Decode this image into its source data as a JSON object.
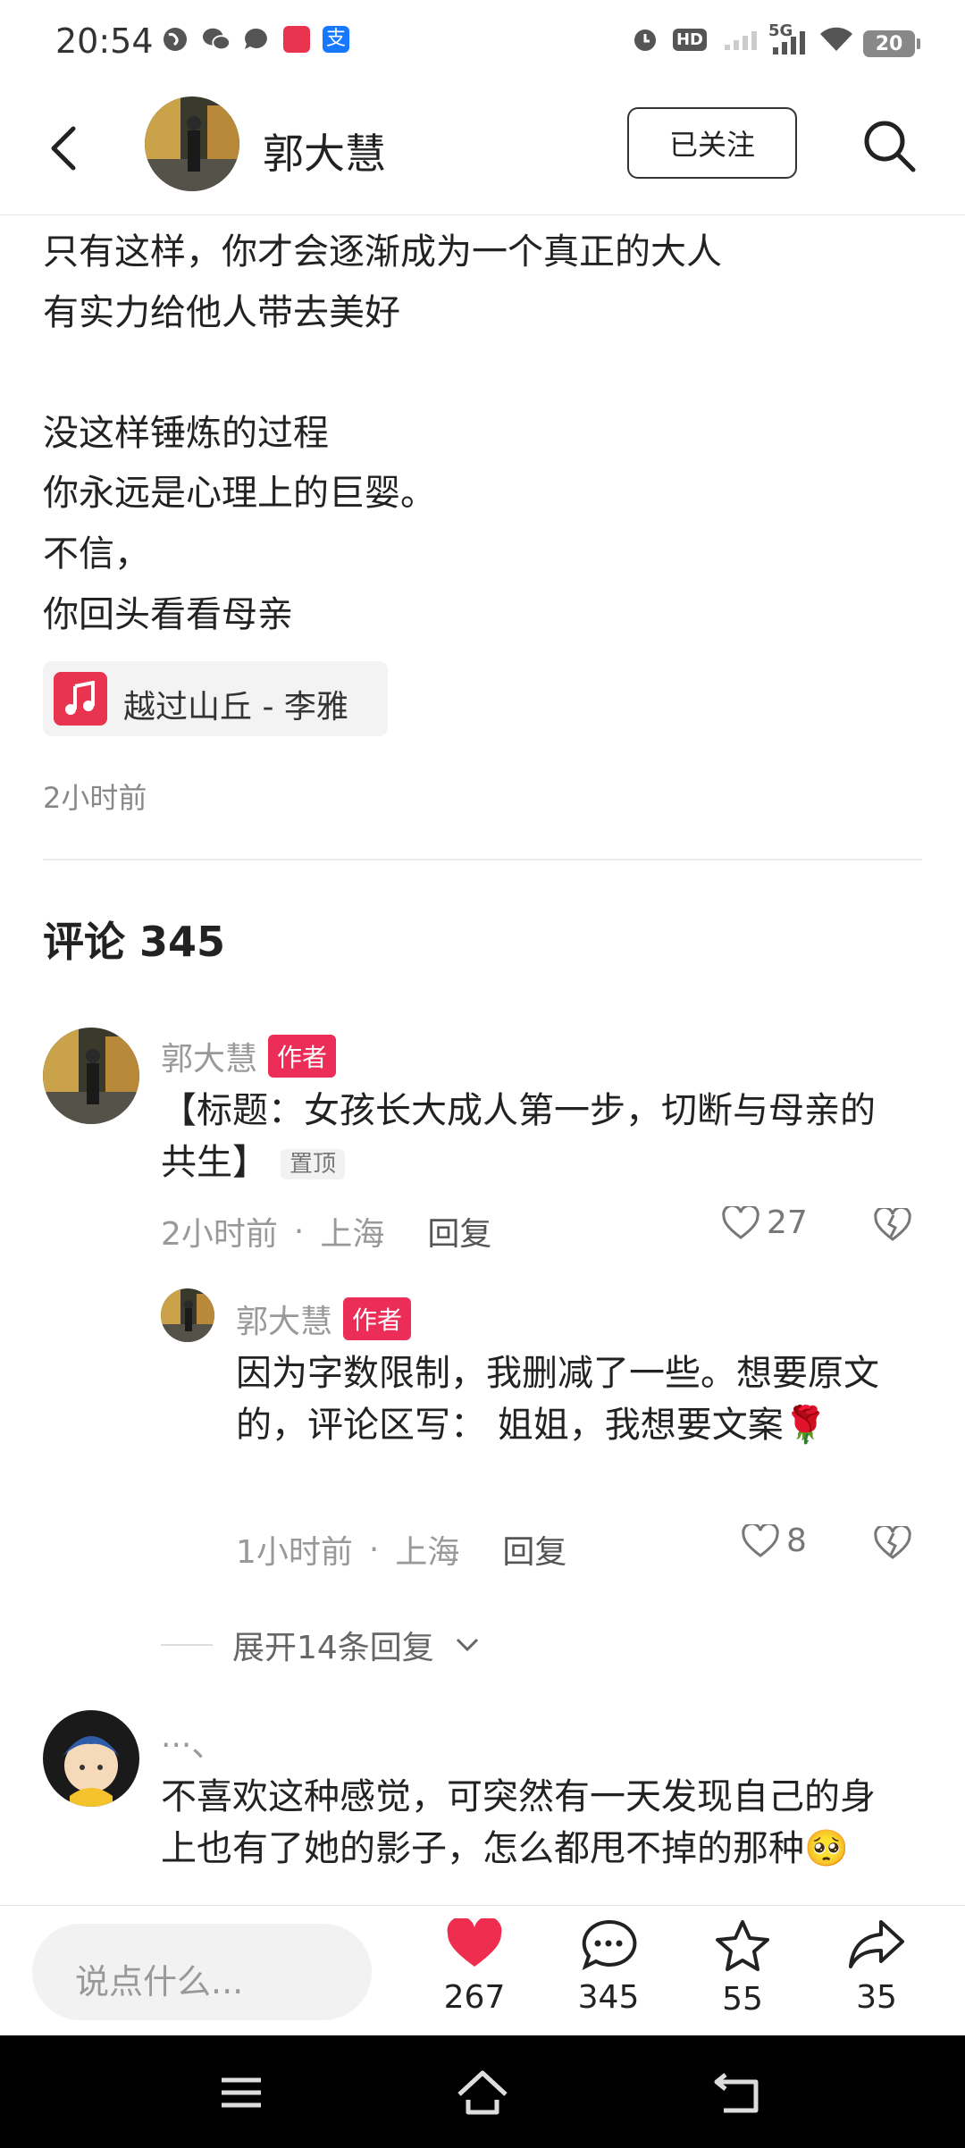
{
  "status_bar": {
    "time": "20:54",
    "battery": "20",
    "network": "5G"
  },
  "header": {
    "name": "郭大慧",
    "follow_label": "已关注"
  },
  "post": {
    "lines": [
      "只有这样，你才会逐渐成为一个真正的大人",
      "有实力给他人带去美好",
      "没这样锤炼的过程",
      "你永远是心理上的巨婴。",
      "不信，",
      "你回头看看母亲"
    ],
    "music": "越过山丘 - 李雅",
    "time": "2小时前"
  },
  "comments_title": "评论 345",
  "comments": [
    {
      "name": "郭大慧",
      "badge": "作者",
      "text": "【标题：女孩长大成人第一步，切断与母亲的共生】",
      "pin": "置顶",
      "time": "2小时前",
      "location": "上海",
      "reply": "回复",
      "likes": "27"
    },
    {
      "name": "郭大慧",
      "badge": "作者",
      "text": "因为字数限制，我删减了一些。想要原文的，评论区写： 姐姐，我想要文案🌹",
      "time": "1小时前",
      "location": "上海",
      "reply": "回复",
      "likes": "8"
    },
    {
      "name": "···、",
      "text": "不喜欢这种感觉，可突然有一天发现自己的身上也有了她的影子，怎么都甩不掉的那种🥺"
    }
  ],
  "expand_replies": "展开14条回复",
  "separator_dot": "·",
  "bottom_bar": {
    "input_placeholder": "说点什么...",
    "likes": "267",
    "comments": "345",
    "favorites": "55",
    "shares": "35"
  },
  "colors": {
    "accent": "#ec2d57",
    "like_red": "#ef2d4e"
  }
}
